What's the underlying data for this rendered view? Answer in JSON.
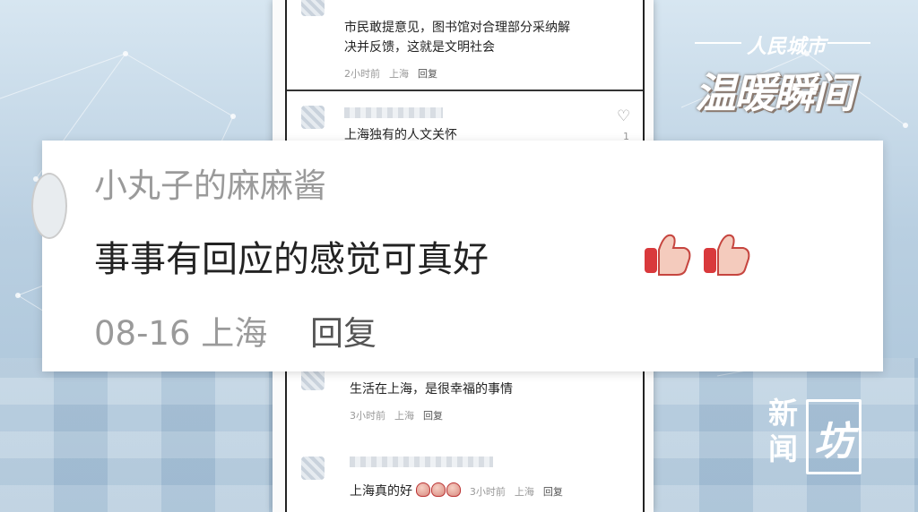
{
  "comments": [
    {
      "text_line1": "市民敢提意见，图书馆对合理部分采纳解",
      "text_line2": "决并反馈，这就是文明社会",
      "time": "2小时前",
      "location": "上海",
      "reply": "回复"
    },
    {
      "text": "上海独有的人文关怀",
      "like_count": "1"
    },
    {
      "text": "生活在上海，是很幸福的事情",
      "time": "3小时前",
      "location": "上海",
      "reply": "回复"
    },
    {
      "text": "上海真的好",
      "time": "3小时前",
      "location": "上海",
      "reply": "回复"
    }
  ],
  "zoom": {
    "nickname": "小丸子的麻麻酱",
    "text": "事事有回应的感觉可真好",
    "date": "08-16",
    "location": "上海",
    "reply": "回复"
  },
  "logos": {
    "channel_small": "人民城市",
    "program_title": "温暖瞬间",
    "news_chars": "新闻",
    "news_mark": "坊"
  },
  "icons": {
    "like": "heart-icon",
    "thumbs": "thumbs-up-emoji"
  },
  "colors": {
    "accent_thumb": "#d9393c",
    "meta_gray": "#999999"
  }
}
